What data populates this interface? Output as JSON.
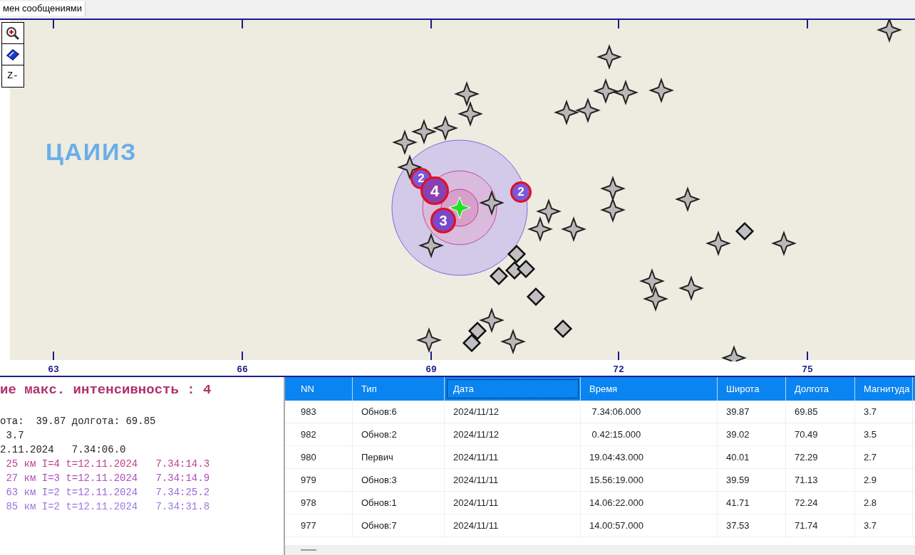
{
  "tab_title": "мен сообщениями",
  "map_tools": [
    {
      "kind": "zoom"
    },
    {
      "kind": "eraser"
    },
    {
      "kind": "text",
      "label": "Z-"
    }
  ],
  "logo": {
    "text": "ЦАИИЗ"
  },
  "intensity_badges": [
    {
      "text": "2"
    },
    {
      "text": "4"
    },
    {
      "text": "3"
    },
    {
      "text": "2"
    }
  ],
  "axis_labels": [
    "63",
    "66",
    "69",
    "72",
    "75"
  ],
  "report": {
    "title": "ие макс. интенсивность : 4",
    "lines": [
      {
        "kind": "plain",
        "text": "ота:  39.87 долгота: 69.85"
      },
      {
        "kind": "plain",
        "text": " 3.7"
      },
      {
        "kind": "plain",
        "text": "2.11.2024   7.34:06.0"
      },
      {
        "kind": "station",
        "color": "#c03c8c",
        "text": " 25 км I=4 t=12.11.2024   7.34:14.3"
      },
      {
        "kind": "station",
        "color": "#b04cc0",
        "text": " 27 км I=3 t=12.11.2024   7.34:14.9"
      },
      {
        "kind": "station",
        "color": "#9a68d8",
        "text": " 63 км I=2 t=12.11.2024   7.34:25.2"
      },
      {
        "kind": "station",
        "color": "#9a78e0",
        "text": " 85 км I=2 t=12.11.2024   7.34:31.8"
      }
    ]
  },
  "table": {
    "columns": [
      {
        "label": "NN",
        "focused": false
      },
      {
        "label": "Тип",
        "focused": false
      },
      {
        "label": "Дата",
        "focused": true
      },
      {
        "label": "Время",
        "focused": false
      },
      {
        "label": "Широта",
        "focused": false
      },
      {
        "label": "Долгота",
        "focused": false
      },
      {
        "label": "Магнитуда",
        "focused": false
      }
    ],
    "rows": [
      [
        "983",
        "Обнов:6",
        "2024/11/12",
        " 7.34:06.000",
        "39.87",
        "69.85",
        "3.7"
      ],
      [
        "982",
        "Обнов:2",
        "2024/11/12",
        " 0.42:15.000",
        "39.02",
        "70.49",
        "3.5"
      ],
      [
        "980",
        "Первич",
        "2024/11/11",
        "19.04:43.000",
        "40.01",
        "72.29",
        "2.7"
      ],
      [
        "979",
        "Обнов:3",
        "2024/11/11",
        "15.56:19.000",
        "39.59",
        "71.13",
        "2.9"
      ],
      [
        "978",
        "Обнов:1",
        "2024/11/11",
        "14.06:22.000",
        "41.71",
        "72.24",
        "2.8"
      ],
      [
        "977",
        "Обнов:7",
        "2024/11/11",
        "14.00:57.000",
        "37.53",
        "71.74",
        "3.7"
      ]
    ]
  }
}
